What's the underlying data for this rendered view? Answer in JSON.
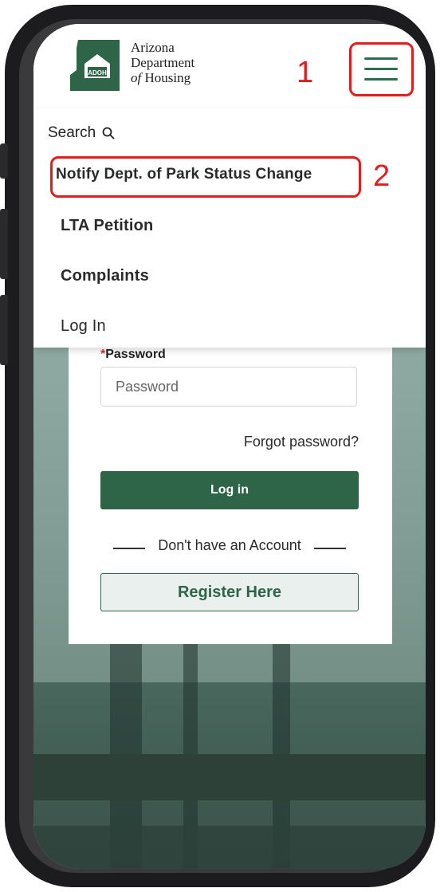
{
  "header": {
    "logo_badge": "ADOH",
    "logo_lines": [
      "Arizona",
      "Department",
      "of",
      "Housing"
    ]
  },
  "menu": {
    "search_label": "Search",
    "items": [
      {
        "label": "Notify Dept. of Park Status Change"
      },
      {
        "label": "LTA Petition"
      },
      {
        "label": "Complaints"
      },
      {
        "label": "Log In"
      }
    ]
  },
  "login": {
    "password_label": "Password",
    "password_placeholder": "Password",
    "forgot_label": "Forgot password?",
    "login_button": "Log in",
    "divider_text": "Don't have an Account",
    "register_button": "Register Here"
  },
  "annotations": {
    "hamburger_step": "1",
    "menu_item_step": "2"
  },
  "colors": {
    "brand_green": "#2e6447",
    "annotation_red": "#e11d1d"
  }
}
